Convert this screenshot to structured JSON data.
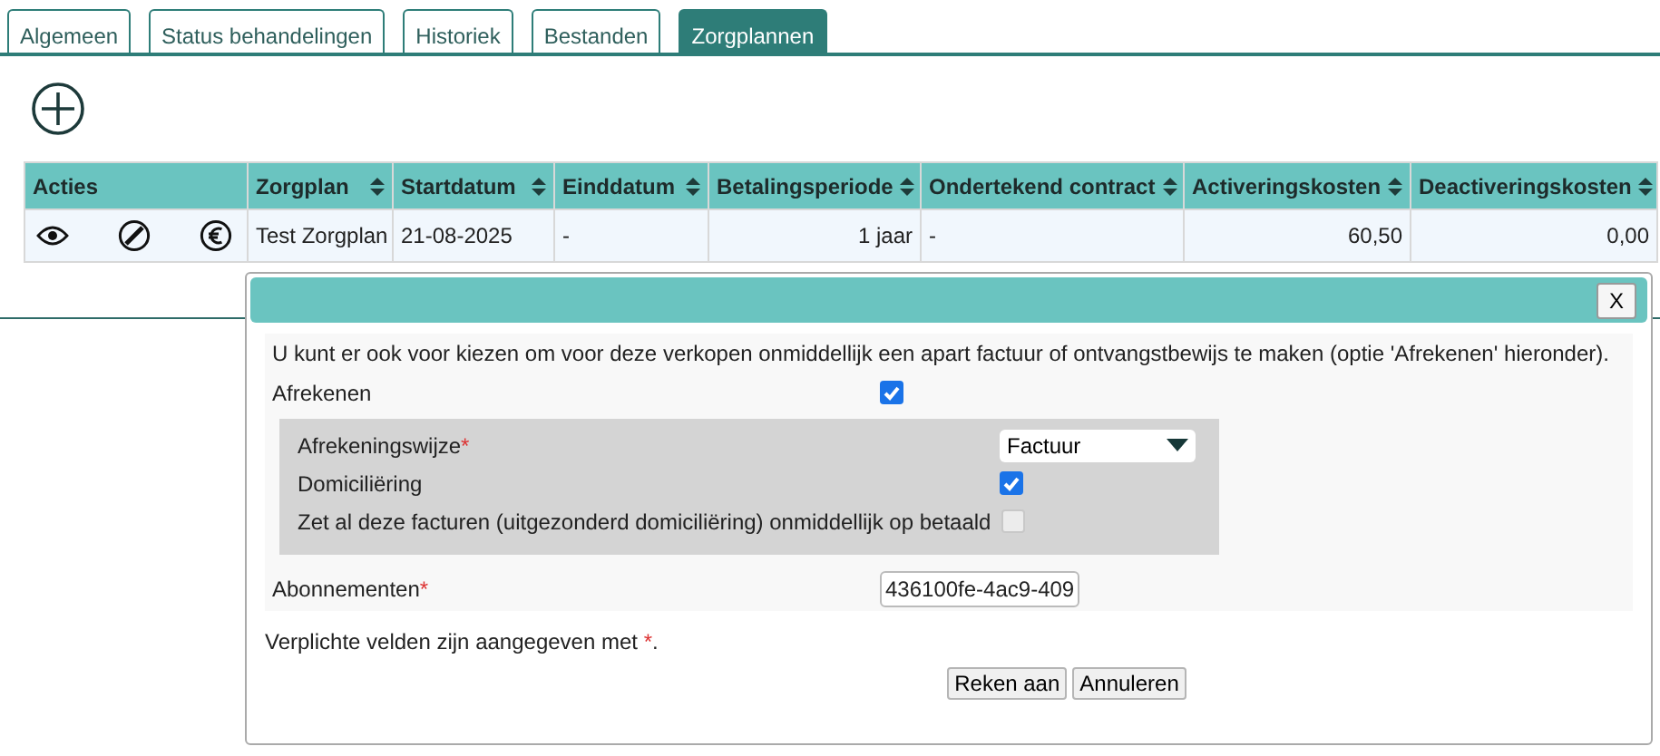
{
  "tabs": [
    {
      "label": "Algemeen",
      "selected": false
    },
    {
      "label": "Status behandelingen",
      "selected": false
    },
    {
      "label": "Historiek",
      "selected": false
    },
    {
      "label": "Bestanden",
      "selected": false
    },
    {
      "label": "Zorgplannen",
      "selected": true
    }
  ],
  "table": {
    "columns": [
      {
        "label": "Acties",
        "sortable": false
      },
      {
        "label": "Zorgplan",
        "sortable": true
      },
      {
        "label": "Startdatum",
        "sortable": true
      },
      {
        "label": "Einddatum",
        "sortable": true
      },
      {
        "label": "Betalingsperiode",
        "sortable": true
      },
      {
        "label": "Ondertekend contract",
        "sortable": true
      },
      {
        "label": "Activeringskosten",
        "sortable": true
      },
      {
        "label": "Deactiveringskosten",
        "sortable": true
      }
    ],
    "rows": [
      {
        "actions": [
          {
            "kind": "view"
          },
          {
            "kind": "deactivate"
          },
          {
            "kind": "pay"
          }
        ],
        "cells": [
          "",
          "Test Zorgplan",
          "21-08-2025",
          "-",
          "1 jaar",
          "-",
          "60,50",
          "0,00"
        ]
      }
    ]
  },
  "dialog": {
    "close_label": "X",
    "intro": "U kunt er ook voor kiezen om voor deze verkopen onmiddellijk een apart factuur of ontvangstbewijs te maken (optie 'Afrekenen' hieronder).",
    "afrekenen": {
      "label": "Afrekenen",
      "checked": true
    },
    "panel": [
      {
        "kind": "select",
        "label": "Afrekeningswijze",
        "required_mark": "*",
        "value": "Factuur"
      },
      {
        "kind": "checkbox",
        "label": "Domiciliëring",
        "checked": true,
        "disabled": false
      },
      {
        "kind": "checkbox",
        "label": "Zet al deze facturen (uitgezonderd domiciliëring) onmiddellijk op betaald",
        "checked": false,
        "disabled": true
      }
    ],
    "abonnementen": {
      "label": "Abonnementen",
      "required_mark": "*",
      "value": "436100fe-4ac9-409"
    },
    "note": {
      "text": "Verplichte velden zijn aangegeven met ",
      "mark": "*",
      "end": "."
    },
    "buttons": [
      "Reken aan",
      "Annuleren"
    ]
  }
}
